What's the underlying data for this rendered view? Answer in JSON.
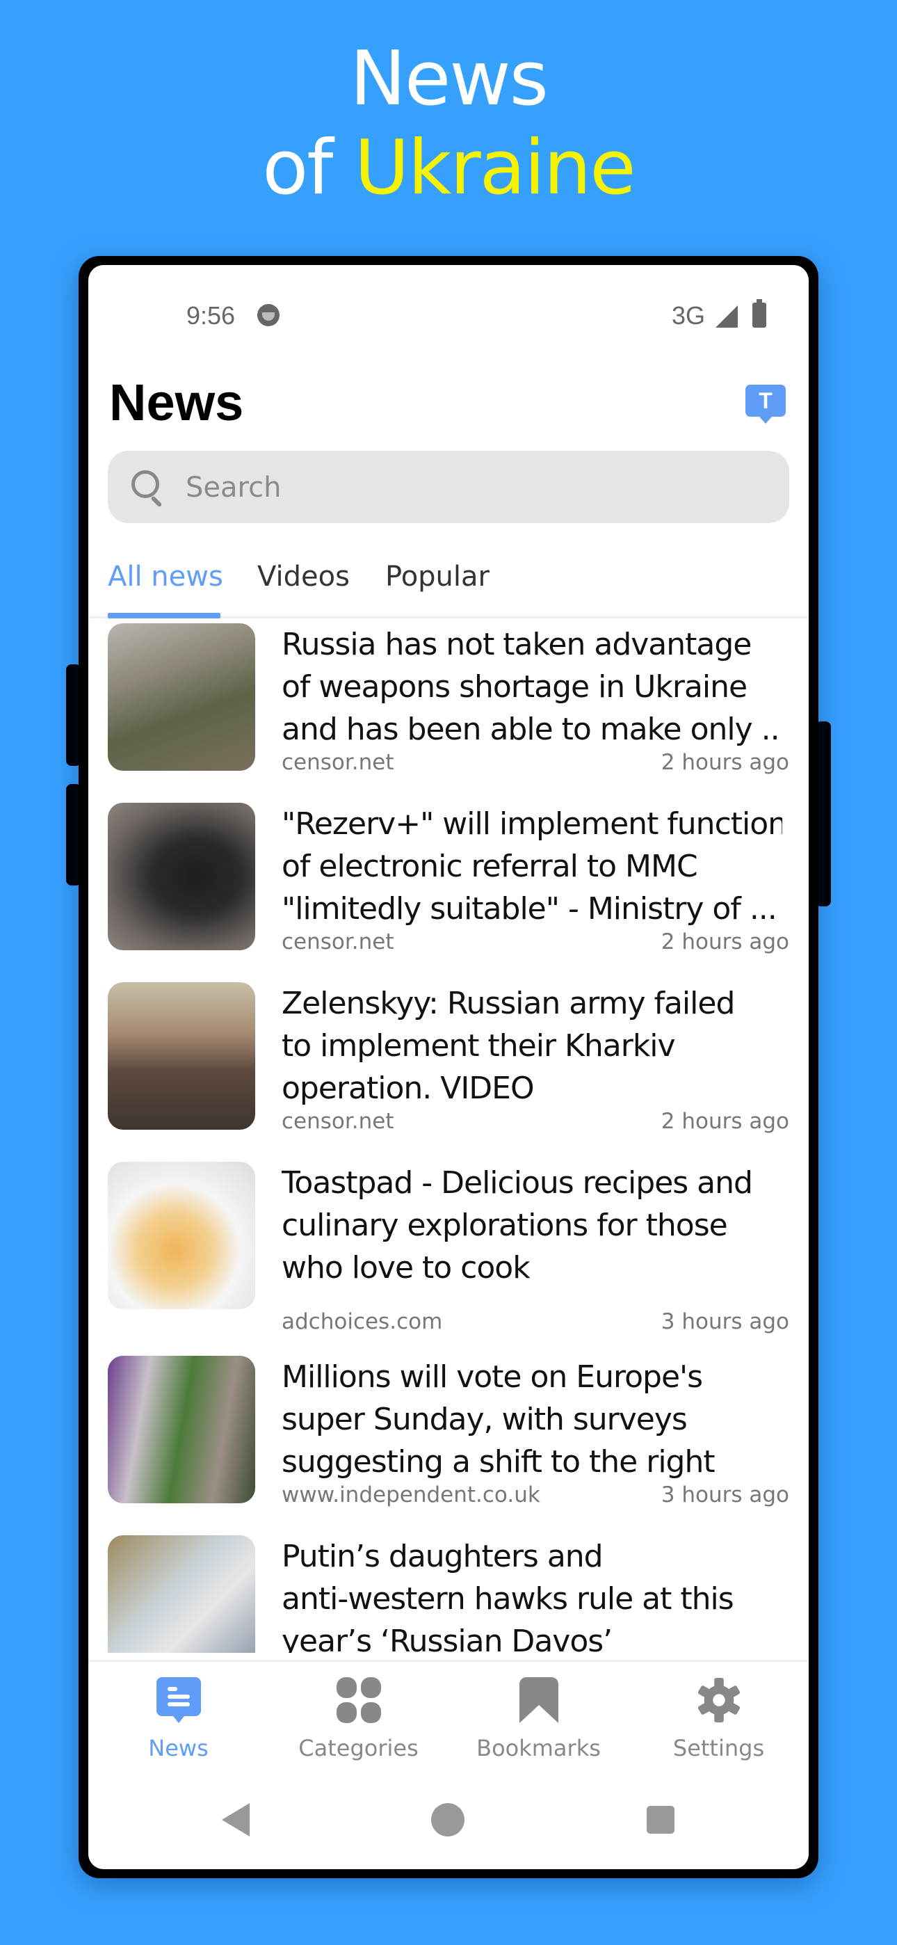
{
  "promo": {
    "line1": "News",
    "line2_prefix": "of ",
    "line2_accent": "Ukraine"
  },
  "status_bar": {
    "time": "9:56",
    "network": "3G"
  },
  "header": {
    "title": "News",
    "translate_icon_label": "T"
  },
  "search": {
    "placeholder": "Search",
    "value": ""
  },
  "tabs": [
    {
      "label": "All news",
      "active": true
    },
    {
      "label": "Videos",
      "active": false
    },
    {
      "label": "Popular",
      "active": false
    }
  ],
  "articles": [
    {
      "headline_lines": [
        "Russia has not taken advantage",
        "of weapons shortage in Ukraine",
        "and has been able to make only ..."
      ],
      "source": "censor.net",
      "time": "2 hours ago",
      "thumb": "soldiers"
    },
    {
      "headline_lines": [
        "\"Rezerv+\" will implement function",
        "of electronic referral to MMC",
        "\"limitedly suitable\" - Ministry of ..."
      ],
      "source": "censor.net",
      "time": "2 hours ago",
      "thumb": "phone-app"
    },
    {
      "headline_lines": [
        "Zelenskyy: Russian army failed",
        "to implement their Kharkiv",
        "operation. VIDEO"
      ],
      "source": "censor.net",
      "time": "2 hours ago",
      "thumb": "portrait"
    },
    {
      "headline_lines": [
        "Toastpad - Delicious recipes and",
        "culinary explorations for those",
        "who love to cook"
      ],
      "source": "adchoices.com",
      "time": "3 hours ago",
      "thumb": "soup"
    },
    {
      "headline_lines": [
        "Millions will vote on Europe's",
        "super Sunday, with surveys",
        "suggesting a shift to the right"
      ],
      "source": "www.independent.co.uk",
      "time": "3 hours ago",
      "thumb": "street-posters"
    },
    {
      "headline_lines": [
        "Putin’s daughters and",
        "anti-western hawks rule at this",
        "year’s ‘Russian Davos’"
      ],
      "source": "",
      "time": "",
      "thumb": "blurred"
    }
  ],
  "bottom_nav": [
    {
      "label": "News",
      "icon": "news-bubble-icon",
      "active": true
    },
    {
      "label": "Categories",
      "icon": "grid-icon",
      "active": false
    },
    {
      "label": "Bookmarks",
      "icon": "bookmark-icon",
      "active": false
    },
    {
      "label": "Settings",
      "icon": "gear-icon",
      "active": false
    }
  ],
  "colors": {
    "background": "#36a0fd",
    "accent": "#5f9df8",
    "promo_accent": "#f7f300",
    "muted": "#888888"
  }
}
